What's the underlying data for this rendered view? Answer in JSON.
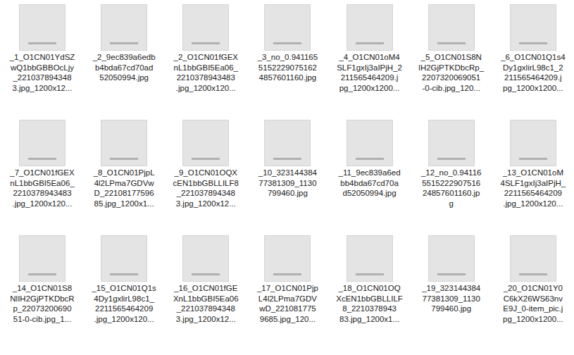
{
  "files": [
    {
      "lines": [
        "_1_O1CN01YdSZ",
        "wQ1bbGBBOcLjy",
        "_221037894348",
        "3.jpg_1200x12..."
      ]
    },
    {
      "lines": [
        "_2_9ec839a6edb",
        "b4bda67cd70ad",
        "52050994.jpg"
      ]
    },
    {
      "lines": [
        "_2_O1CN01fGEX",
        "nL1bbGBI5Ea06_",
        "2210378943483",
        ".jpg_1200x120..."
      ]
    },
    {
      "lines": [
        "_3_no_0.941165",
        "5152229075162",
        "4857601160.jpg"
      ]
    },
    {
      "lines": [
        "_4_O1CN01oM4",
        "SLF1gxIj3aIPjH_2",
        "211565464209.j",
        "pg_1200x1200..."
      ]
    },
    {
      "lines": [
        "_5_O1CN01S8N",
        "lH2GjPTKDbcRp_",
        "2207320069051",
        "-0-cib.jpg_120..."
      ]
    },
    {
      "lines": [
        "_6_O1CN01Q1s4",
        "Dy1gxlirL98c1_2",
        "211565464209.j",
        "pg_1200x1200..."
      ]
    },
    {
      "lines": [
        "_7_O1CN01fGEX",
        "nL1bbGBI5Ea06_",
        "2210378943483",
        ".jpg_1200x120..."
      ]
    },
    {
      "lines": [
        "_8_O1CN01PjpL",
        "4l2LPma7GDVw",
        "D_22108177596",
        "85.jpg_1200x1..."
      ]
    },
    {
      "lines": [
        "_9_O1CN01OQX",
        "cEN1bbGBLLILF8",
        "_221037894348",
        "3.jpg_1200x12..."
      ]
    },
    {
      "lines": [
        "_10_323144384",
        "77381309_1130",
        "799460.jpg"
      ]
    },
    {
      "lines": [
        "_11_9ec839a6ed",
        "bb4bda67cd70a",
        "d52050994.jpg"
      ]
    },
    {
      "lines": [
        "_12_no_0.94116",
        "5515222907516",
        "24857601160.jp",
        "g"
      ]
    },
    {
      "lines": [
        "_13_O1CN01oM",
        "4SLF1gxIj3aIPjH_",
        "2211565464209",
        ".jpg_1200x120..."
      ]
    },
    {
      "lines": [
        "_14_O1CN01S8",
        "NlIH2GjPTKDbcR",
        "p_22073200690",
        "51-0-cib.jpg_1..."
      ]
    },
    {
      "lines": [
        "_15_O1CN01Q1s",
        "4Dy1gxlirL98c1_",
        "2211565464209",
        ".jpg_1200x120..."
      ]
    },
    {
      "lines": [
        "_16_O1CN01fGE",
        "XnL1bbGBI5Ea06",
        "_221037894348",
        "3.jpg_1200x12..."
      ]
    },
    {
      "lines": [
        "_17_O1CN01Pjp",
        "L4l2LPma7GDV",
        "wD_221081775",
        "9685.jpg_120..."
      ]
    },
    {
      "lines": [
        "_18_O1CN01OQ",
        "XcEN1bbGBLLILF",
        "8_2210378943",
        "83.jpg_1200x1..."
      ]
    },
    {
      "lines": [
        "_19_323144384",
        "77381309_1130",
        "799460.jpg"
      ]
    },
    {
      "lines": [
        "_20_O1CN01Y0",
        "C6kX26WS63nv",
        "E9J_0-item_pic.j",
        "pg_1200x1200..."
      ]
    }
  ]
}
